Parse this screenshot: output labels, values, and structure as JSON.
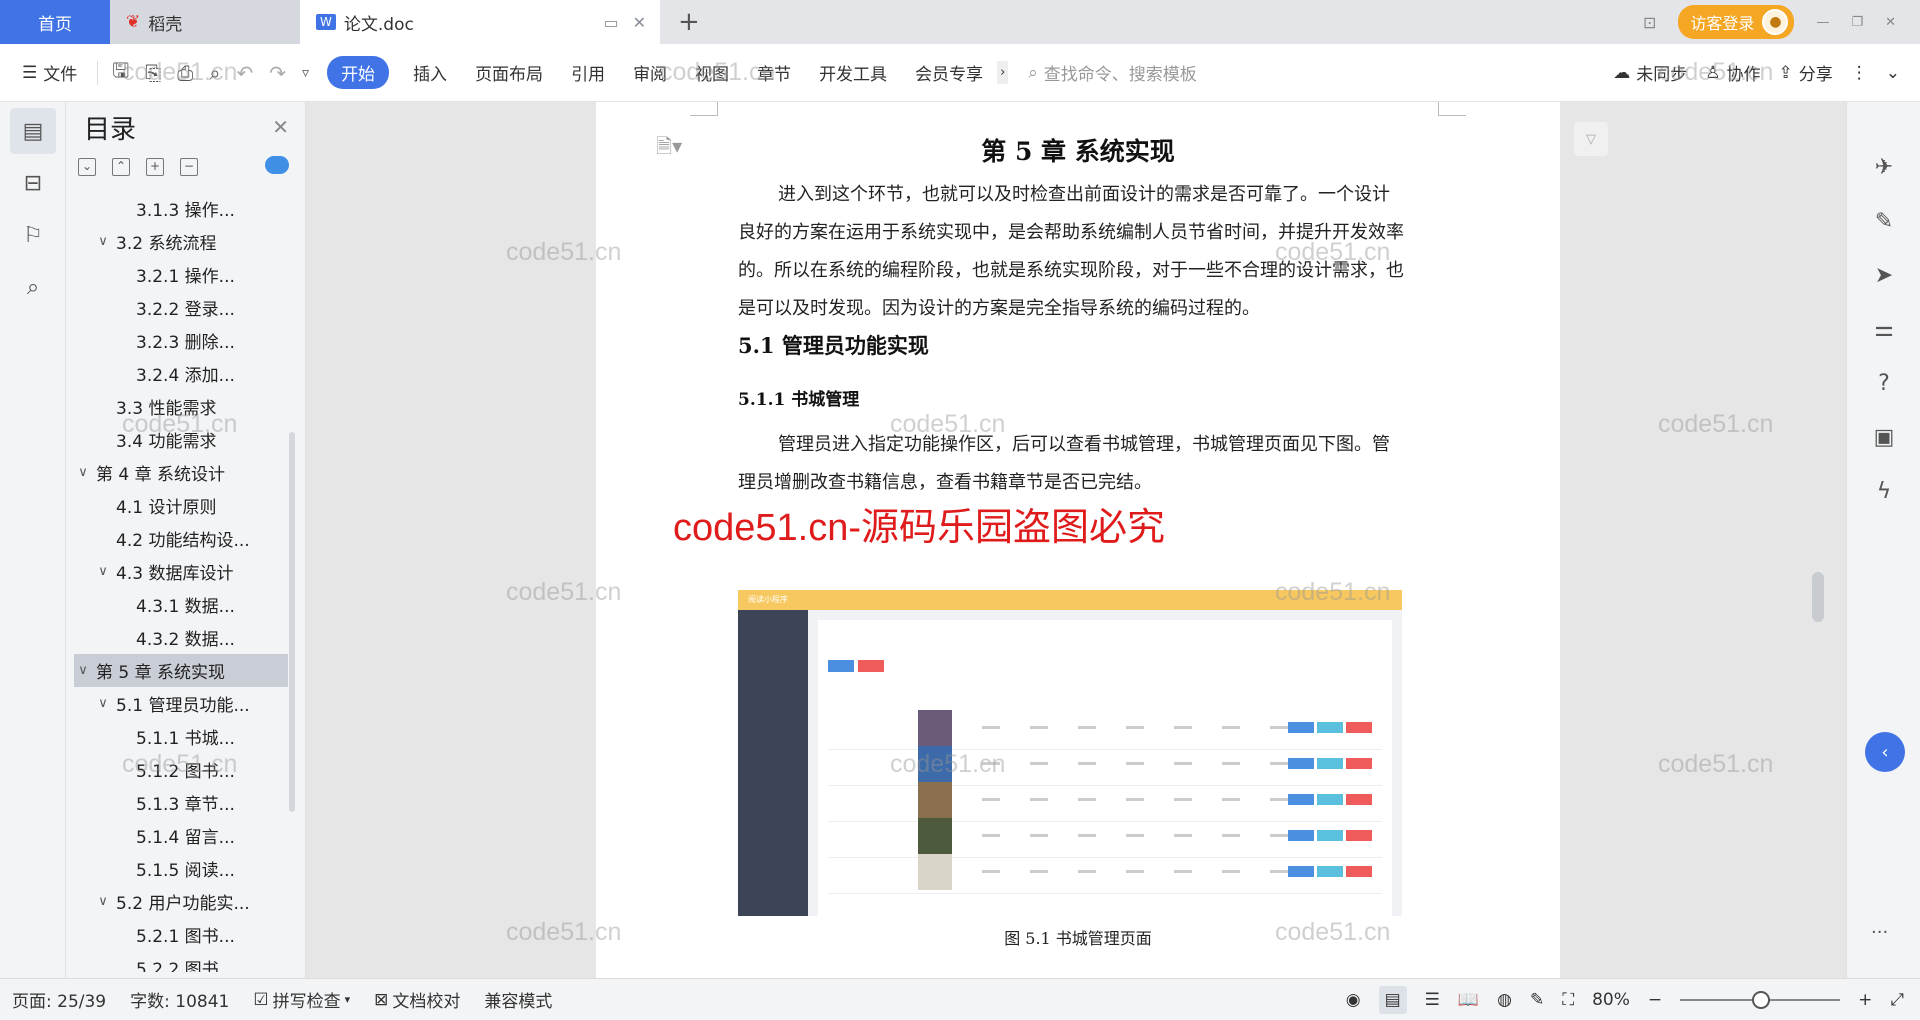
{
  "tabs": {
    "home": "首页",
    "daoke": "稻壳",
    "doc": "论文.doc",
    "visitor": "访客登录"
  },
  "toolbar": {
    "file": "文件",
    "start": "开始",
    "menus": [
      "插入",
      "页面布局",
      "引用",
      "审阅",
      "视图",
      "章节",
      "开发工具",
      "会员专享"
    ],
    "search_placeholder": "查找命令、搜索模板",
    "sync": "未同步",
    "collab": "协作",
    "share": "分享"
  },
  "toc": {
    "title": "目录",
    "items": [
      {
        "level": 3,
        "label": "3.1.3 操作...",
        "arrow": "",
        "selected": false
      },
      {
        "level": 2,
        "label": "3.2 系统流程",
        "arrow": "v",
        "selected": false
      },
      {
        "level": 3,
        "label": "3.2.1 操作...",
        "arrow": "",
        "selected": false
      },
      {
        "level": 3,
        "label": "3.2.2 登录...",
        "arrow": "",
        "selected": false
      },
      {
        "level": 3,
        "label": "3.2.3 删除...",
        "arrow": "",
        "selected": false
      },
      {
        "level": 3,
        "label": "3.2.4 添加...",
        "arrow": "",
        "selected": false
      },
      {
        "level": 2,
        "label": "3.3 性能需求",
        "arrow": "",
        "selected": false
      },
      {
        "level": 2,
        "label": "3.4 功能需求",
        "arrow": "",
        "selected": false
      },
      {
        "level": 1,
        "label": "第 4 章 系统设计",
        "arrow": "v",
        "selected": false
      },
      {
        "level": 2,
        "label": "4.1 设计原则",
        "arrow": "",
        "selected": false
      },
      {
        "level": 2,
        "label": "4.2 功能结构设...",
        "arrow": "",
        "selected": false
      },
      {
        "level": 2,
        "label": "4.3 数据库设计",
        "arrow": "v",
        "selected": false
      },
      {
        "level": 3,
        "label": "4.3.1 数据...",
        "arrow": "",
        "selected": false
      },
      {
        "level": 3,
        "label": "4.3.2 数据...",
        "arrow": "",
        "selected": false
      },
      {
        "level": 1,
        "label": "第 5 章 系统实现",
        "arrow": "v",
        "selected": true
      },
      {
        "level": 2,
        "label": "5.1 管理员功能...",
        "arrow": "v",
        "selected": false
      },
      {
        "level": 3,
        "label": "5.1.1 书城...",
        "arrow": "",
        "selected": false
      },
      {
        "level": 3,
        "label": "5.1.2 图书...",
        "arrow": "",
        "selected": false
      },
      {
        "level": 3,
        "label": "5.1.3 章节...",
        "arrow": "",
        "selected": false
      },
      {
        "level": 3,
        "label": "5.1.4 留言...",
        "arrow": "",
        "selected": false
      },
      {
        "level": 3,
        "label": "5.1.5 阅读...",
        "arrow": "",
        "selected": false
      },
      {
        "level": 2,
        "label": "5.2 用户功能实...",
        "arrow": "v",
        "selected": false
      },
      {
        "level": 3,
        "label": "5.2.1 图书...",
        "arrow": "",
        "selected": false
      },
      {
        "level": 3,
        "label": "5.2.2 图书...",
        "arrow": "",
        "selected": false
      }
    ]
  },
  "document": {
    "chapter_title": "第 5 章  系统实现",
    "intro": "进入到这个环节，也就可以及时检查出前面设计的需求是否可靠了。一个设计良好的方案在运用于系统实现中，是会帮助系统编制人员节省时间，并提升开发效率的。所以在系统的编程阶段，也就是系统实现阶段，对于一些不合理的设计需求，也是可以及时发现。因为设计的方案是完全指导系统的编码过程的。",
    "section": "5.1  管理员功能实现",
    "subsection": "5.1.1  书城管理",
    "body": "管理员进入指定功能操作区，后可以查看书城管理，书城管理页面见下图。管理员增删改查书籍信息，查看书籍章节是否已完结。",
    "caption": "图 5.1  书城管理页面",
    "figure_header": "阅读小程序"
  },
  "watermarks": {
    "text": "code51.cn",
    "red": "code51.cn-源码乐园盗图必究"
  },
  "status": {
    "page": "页面: 25/39",
    "words": "字数: 10841",
    "spell": "拼写检查",
    "proof": "文档校对",
    "compat": "兼容模式",
    "zoom": "80%"
  },
  "colors": {
    "accent": "#3f73e6",
    "visitor": "#f5a623",
    "watermark_red": "#e01b1b"
  }
}
